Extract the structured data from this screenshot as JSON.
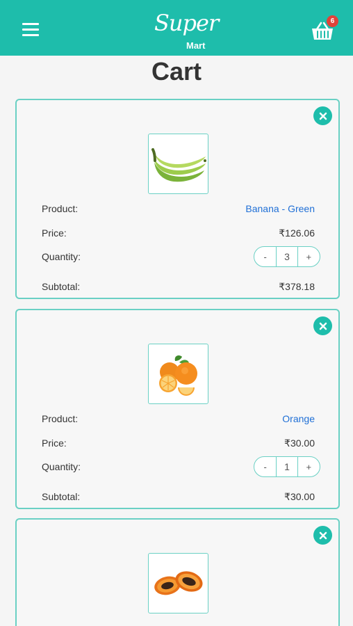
{
  "header": {
    "logo_super": "Super",
    "logo_mart": "Mart",
    "cart_count": "6"
  },
  "page": {
    "title": "Cart"
  },
  "labels": {
    "product": "Product:",
    "price": "Price:",
    "quantity": "Quantity:",
    "subtotal": "Subtotal:",
    "minus": "-",
    "plus": "+"
  },
  "items": [
    {
      "name": "Banana - Green",
      "price": "₹126.06",
      "quantity": "3",
      "subtotal": "₹378.18",
      "image": "banana"
    },
    {
      "name": "Orange",
      "price": "₹30.00",
      "quantity": "1",
      "subtotal": "₹30.00",
      "image": "orange"
    },
    {
      "image": "papaya"
    }
  ],
  "colors": {
    "primary": "#1ebdab",
    "card_border": "#6ad0c4",
    "badge": "#e0423a",
    "link": "#1f6fd6"
  }
}
